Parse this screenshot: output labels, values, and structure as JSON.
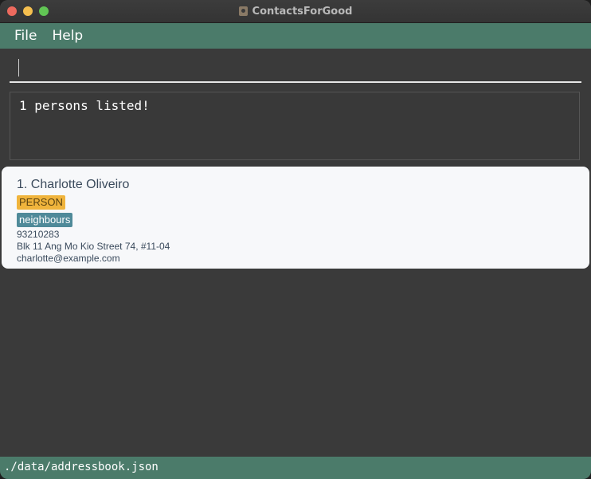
{
  "window": {
    "title": "ContactsForGood",
    "app_icon": "contact-book-icon"
  },
  "menu": {
    "items": [
      {
        "label": "File"
      },
      {
        "label": "Help"
      }
    ]
  },
  "command": {
    "value": "",
    "placeholder": ""
  },
  "result": {
    "message": "1 persons listed!"
  },
  "persons": [
    {
      "index_name": "1. Charlotte Oliveiro",
      "type_tag": "PERSON",
      "group_tag": "neighbours",
      "phone": "93210283",
      "address": "Blk 11 Ang Mo Kio Street 74, #11-04",
      "email": "charlotte@example.com"
    }
  ],
  "status": {
    "file_path": "./data/addressbook.json"
  },
  "colors": {
    "accent": "#4b7b6a",
    "background": "#3a3a3a",
    "card": "#f7f8fa",
    "tag_type": "#f0b43c",
    "tag_group": "#4f8a99"
  }
}
